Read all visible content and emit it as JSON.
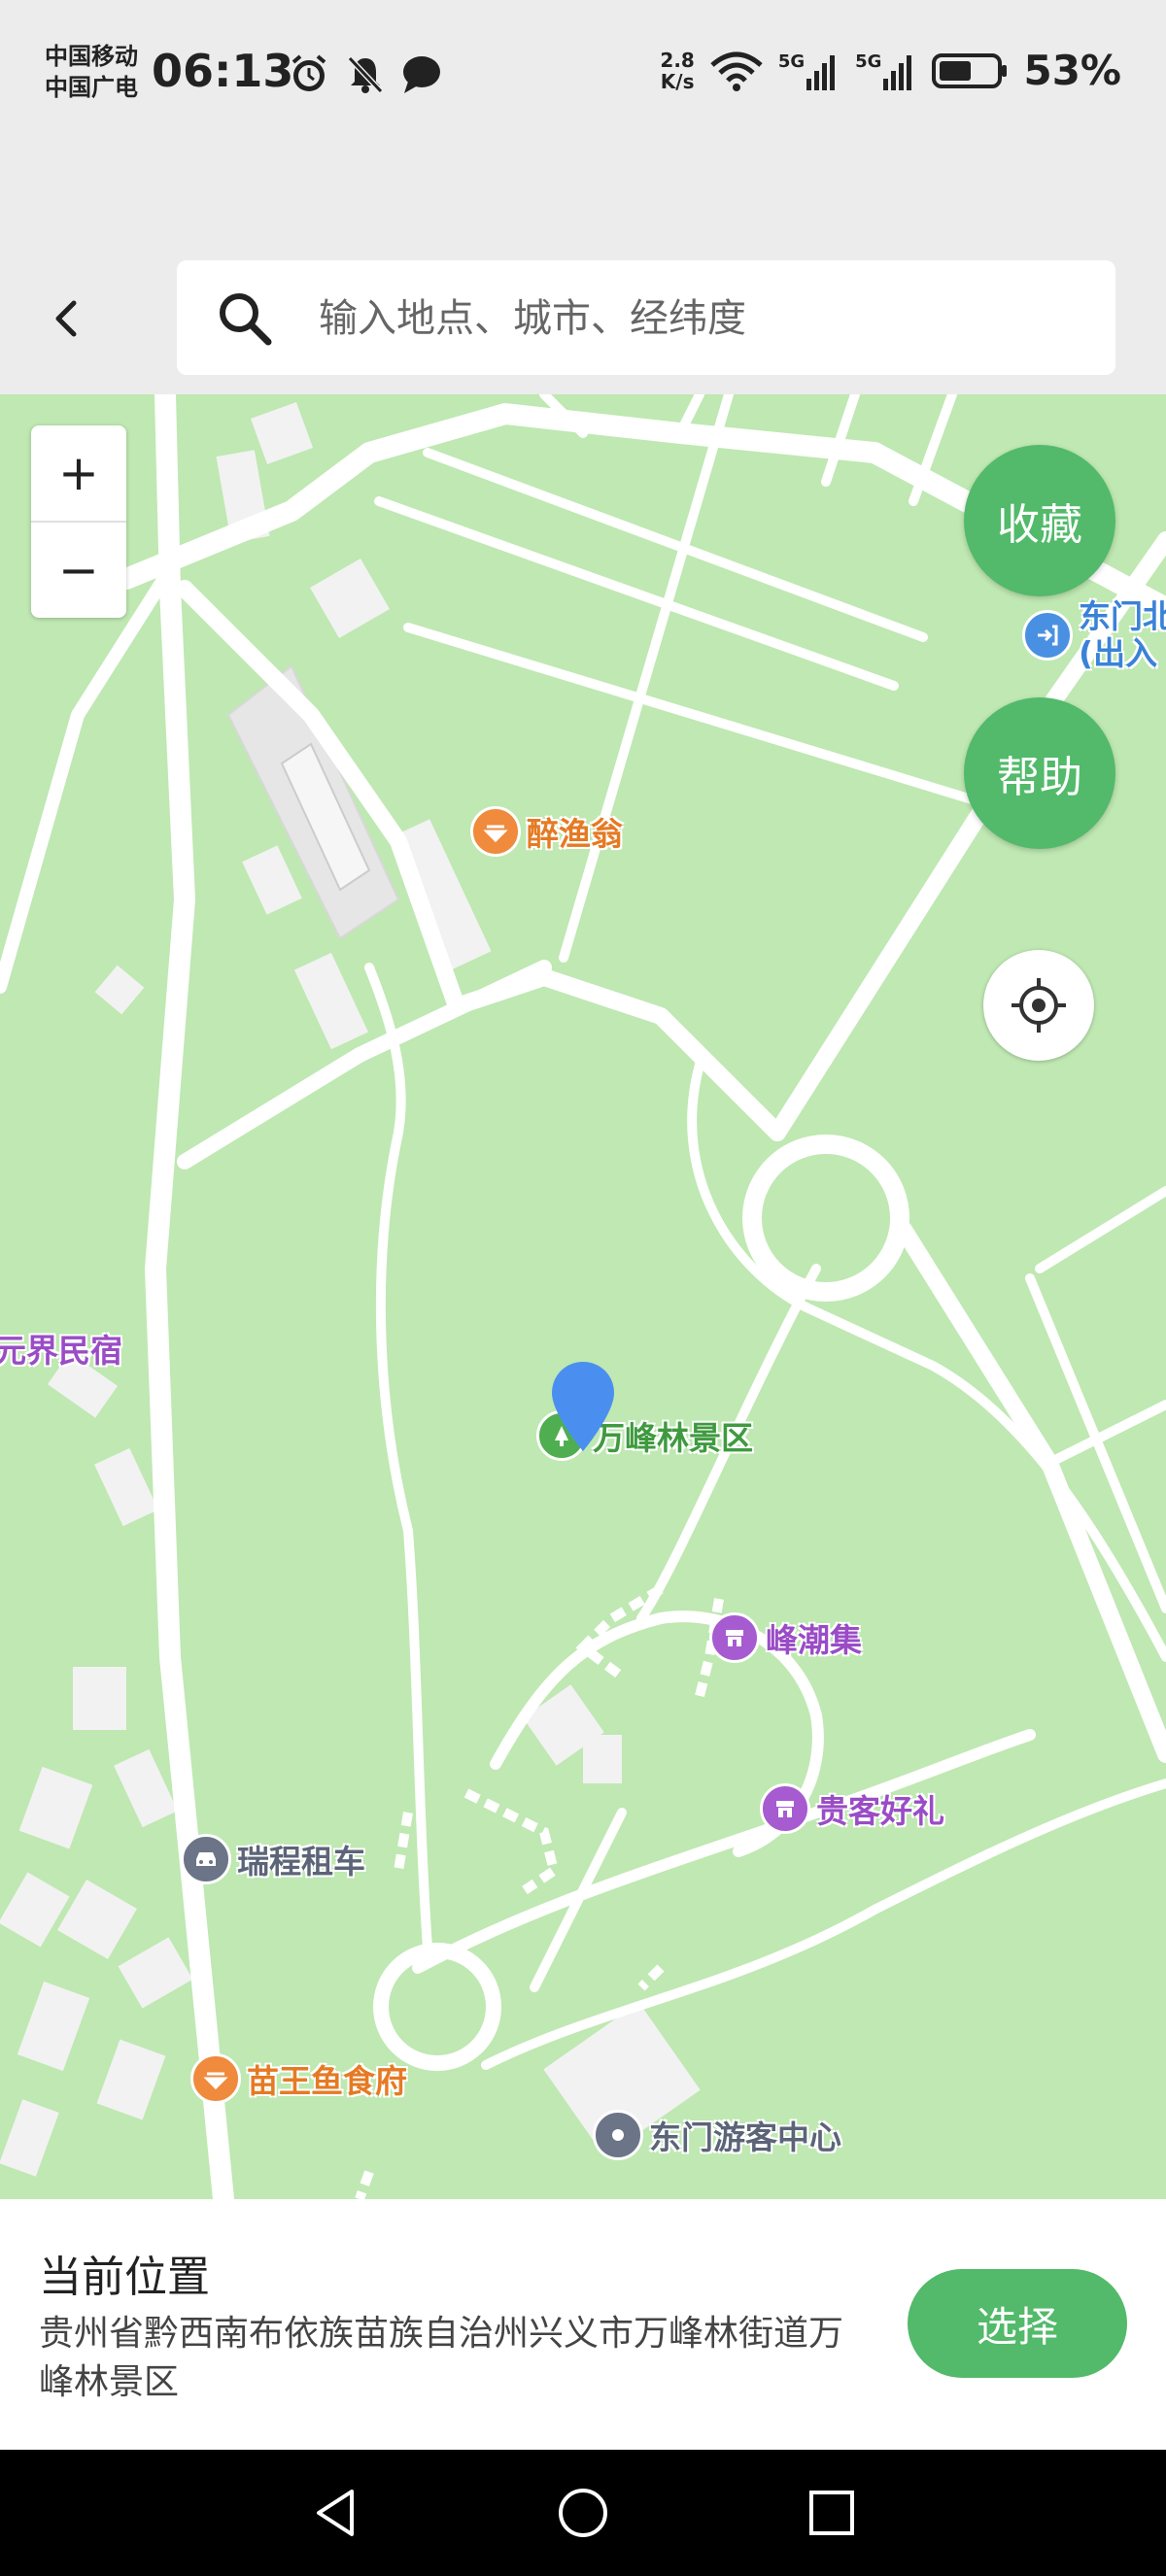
{
  "status_bar": {
    "carrier1": "中国移动",
    "carrier2": "中国广电",
    "time": "06:13",
    "net_speed_value": "2.8",
    "net_speed_unit": "K/s",
    "signal1": "5G",
    "signal2": "5G",
    "battery": "53%",
    "icons": [
      "alarm-icon",
      "bell-off-icon",
      "message-icon",
      "wifi-icon",
      "signal-icon",
      "battery-icon"
    ]
  },
  "header": {
    "search_placeholder": "输入地点、城市、经纬度"
  },
  "map": {
    "zoom_in": "+",
    "zoom_out": "−",
    "favorite_label": "收藏",
    "help_label": "帮助",
    "pois": {
      "east_gate": "东门北\n(出入",
      "zuiyuweng": "醉渔翁",
      "yuanjie": "元界民宿",
      "wanfenglin": "万峰林景区",
      "fengchaoji": "峰潮集",
      "guikehaoli": "贵客好礼",
      "ruicheng": "瑞程租车",
      "miaowangyu": "苗王鱼食府",
      "visitor_center": "东门游客中心"
    }
  },
  "bottom_panel": {
    "title": "当前位置",
    "address": "贵州省黔西南布依族苗族自治州兴义市万峰林街道万峰林景区",
    "select_label": "选择"
  },
  "accent_color": "#52ba6a"
}
